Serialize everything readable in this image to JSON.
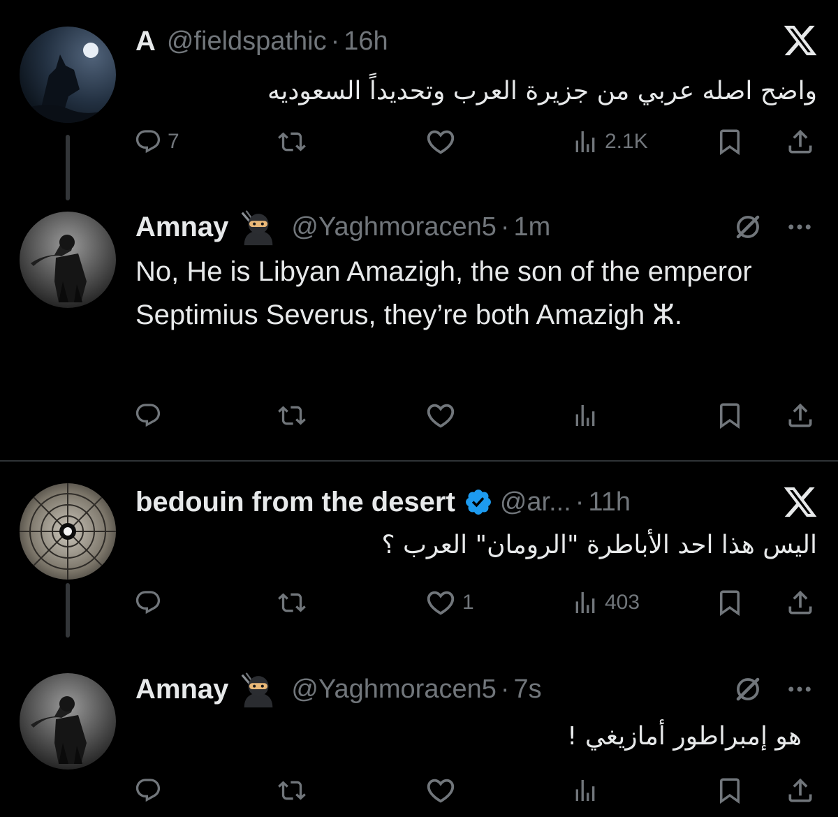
{
  "tweets": [
    {
      "name": "A",
      "handle": "@fieldspathic",
      "separator": "·",
      "time": "16h",
      "text": "واضح اصله عربي من جزيرة العرب وتحديداً السعوديه",
      "replies": "7",
      "reposts": "",
      "likes": "",
      "views": "2.1K"
    },
    {
      "name": "Amnay",
      "handle": "@Yaghmoracen5",
      "separator": "·",
      "time": "1m",
      "text": "No, He is Libyan Amazigh, the son of the emperor Septimius Severus, they’re both Amazigh ⵣ.",
      "replies": "",
      "reposts": "",
      "likes": "",
      "views": ""
    },
    {
      "name": "bedouin from the desert",
      "handle": "@ar...",
      "separator": "·",
      "time": "11h",
      "text": "اليس هذا احد الأباطرة \"الرومان\" العرب ؟",
      "replies": "",
      "reposts": "",
      "likes": "1",
      "views": "403"
    },
    {
      "name": "Amnay",
      "handle": "@Yaghmoracen5",
      "separator": "·",
      "time": "7s",
      "text": "هو إمبراطور أمازيغي !",
      "replies": "",
      "reposts": "",
      "likes": "",
      "views": ""
    }
  ],
  "icons": {
    "reply": "reply-icon",
    "repost": "repost-icon",
    "like": "heart-icon",
    "views": "views-icon",
    "bookmark": "bookmark-icon",
    "share": "share-icon",
    "x_logo": "x-logo-icon",
    "more": "more-icon",
    "grok": "grok-icon",
    "ninja_emoji": "ninja-emoji-icon",
    "verified_badge": "verified-badge-icon"
  },
  "colors": {
    "background": "#000000",
    "text": "#e7e9ea",
    "muted": "#71767b",
    "verified": "#1d9bf0",
    "divider": "#2f3336"
  }
}
